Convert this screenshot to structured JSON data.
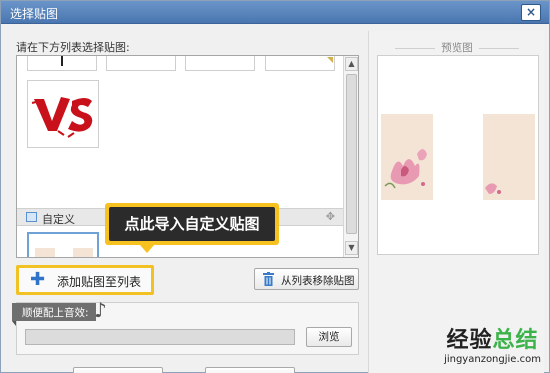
{
  "window": {
    "title": "选择贴图",
    "close_glyph": "×"
  },
  "list": {
    "instruction": "请在下方列表选择贴图:",
    "section_label": "自定义",
    "section_icon": "image-icon",
    "move_icon": "move-icon",
    "move_glyph": "✥"
  },
  "tooltip": {
    "text": "点此导入自定义贴图"
  },
  "buttons": {
    "add": {
      "icon": "plus-icon",
      "glyph": "✚",
      "label": "添加贴图至列表"
    },
    "remove": {
      "icon": "trash-icon",
      "label": "从列表移除贴图"
    },
    "browse": "浏览"
  },
  "audio": {
    "tab_label": "顺便配上音效:",
    "note_icon": "music-note-icon",
    "note_glyph": "♪",
    "value": ""
  },
  "preview": {
    "title": "预览图"
  },
  "watermark": {
    "part1": "经验",
    "part2": "总结",
    "url": "jingyanzongjie.com"
  },
  "colors": {
    "title_bar": "#4a76b0",
    "highlight": "#f2c123",
    "selected_border": "#6ea1d6",
    "paper": "#f4e4d6",
    "accent_green": "#3cb34a"
  }
}
